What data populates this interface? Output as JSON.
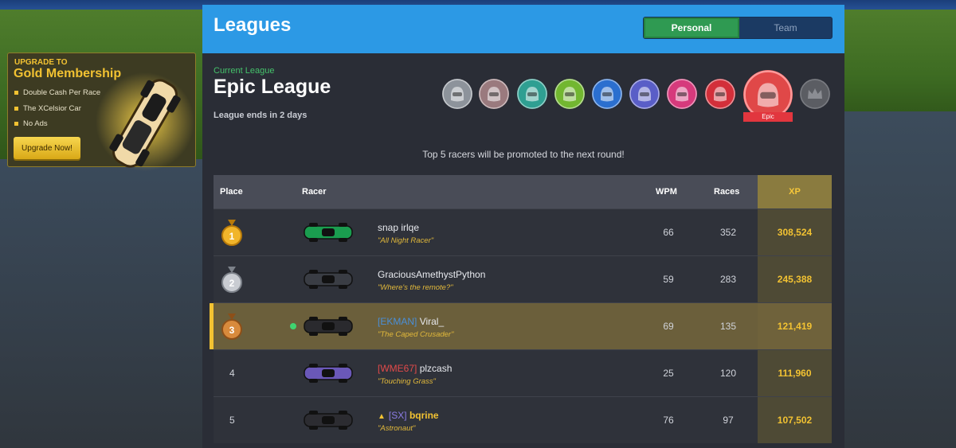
{
  "promo": {
    "kicker": "UPGRADE TO",
    "title": "Gold Membership",
    "perks": [
      "Double Cash Per Race",
      "The XCelsior Car",
      "No Ads"
    ],
    "button": "Upgrade Now!"
  },
  "header": {
    "title": "Leagues",
    "tabs": [
      {
        "label": "Personal",
        "active": true
      },
      {
        "label": "Team",
        "active": false
      }
    ]
  },
  "league": {
    "current_label": "Current League",
    "name": "Epic League",
    "ends": "League ends in 2 days",
    "badge_label": "Epic",
    "tiers": [
      {
        "icon": "helmet-icon",
        "color": "#8d939b"
      },
      {
        "icon": "helmet-icon",
        "color": "#9a7a7e"
      },
      {
        "icon": "helmet-icon",
        "color": "#2f9f92"
      },
      {
        "icon": "helmet-icon",
        "color": "#72b730"
      },
      {
        "icon": "helmet-icon",
        "color": "#2b6fcf"
      },
      {
        "icon": "helmet-icon",
        "color": "#5a5ec7"
      },
      {
        "icon": "helmet-icon",
        "color": "#d63a7c"
      },
      {
        "icon": "helmet-icon",
        "color": "#d32f3a"
      },
      {
        "icon": "helmet-icon",
        "color": "#e04848"
      },
      {
        "icon": "crown-icon",
        "color": "#5b5d63"
      }
    ]
  },
  "promotion_note": "Top 5 racers will be promoted to the next round!",
  "table": {
    "columns": {
      "place": "Place",
      "racer": "Racer",
      "wpm": "WPM",
      "races": "Races",
      "xp": "XP"
    },
    "rows": [
      {
        "place": "1",
        "medal": "gold",
        "tag": "",
        "name": "snap irlqe",
        "title": "\"All Night Racer\"",
        "wpm": "66",
        "races": "352",
        "xp": "308,524"
      },
      {
        "place": "2",
        "medal": "silver",
        "tag": "",
        "name": "GraciousAmethystPython",
        "title": "\"Where's the remote?\"",
        "wpm": "59",
        "races": "283",
        "xp": "245,388"
      },
      {
        "place": "3",
        "medal": "bronze",
        "tag": "[EKMAN]",
        "name": "Viral_",
        "title": "\"The Caped Crusader\"",
        "wpm": "69",
        "races": "135",
        "xp": "121,419",
        "is_me": true
      },
      {
        "place": "4",
        "medal": "",
        "tag": "[WME67]",
        "name": "plzcash",
        "title": "\"Touching Grass\"",
        "wpm": "25",
        "races": "120",
        "xp": "111,960"
      },
      {
        "place": "5",
        "medal": "",
        "tag": "[SX]",
        "name": "bqrine",
        "title": "\"Astronaut\"",
        "wpm": "76",
        "races": "97",
        "xp": "107,502"
      }
    ]
  },
  "colors": {
    "accent_blue": "#2c99e5",
    "gold": "#f2c232",
    "green": "#2f9a52"
  }
}
